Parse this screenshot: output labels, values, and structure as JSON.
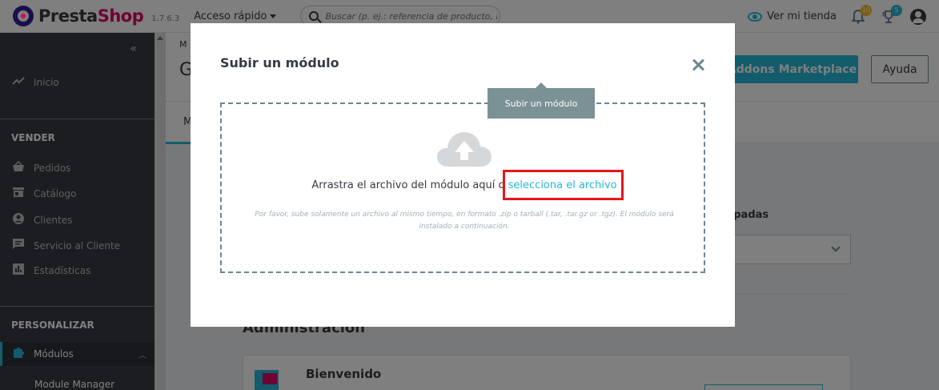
{
  "header": {
    "logo_part1": "Presta",
    "logo_part2": "Shop",
    "version": "1.7.6.3",
    "quick_access": "Acceso rápido",
    "search_placeholder": "Buscar (p. ej.: referencia de producto, no",
    "view_shop": "Ver mi tienda",
    "notifications_count": "10",
    "trophy_count": "5"
  },
  "sidebar": {
    "home": "Inicio",
    "section_sell": "VENDER",
    "items": [
      "Pedidos",
      "Catálogo",
      "Clientes",
      "Servicio al Cliente",
      "Estadísticas"
    ],
    "section_customize": "PERSONALIZAR",
    "active_item": "Módulos",
    "sub_item": "Module Manager"
  },
  "main": {
    "breadcrumb": "M",
    "title_fragment": "G",
    "tab_fragment": "M",
    "addons_button": "Addons Marketplace",
    "help_button": "Ayuda",
    "filter_label": "upadas",
    "section_heading": "Administración",
    "module_name": "Bienvenido"
  },
  "modal": {
    "title": "Subir un módulo",
    "tooltip": "Subir un módulo",
    "drop_text": "Arrastra el archivo del módulo aquí o ",
    "select_link": "selecciona el archivo",
    "hint": "Por favor, sube solamente un archivo al mismo tiempo, en formato .zip o tarball (.tar, .tar.gz or .tgz). El módulo será instalado a continuación."
  },
  "colors": {
    "accent": "#25b9d7",
    "brand_pink": "#df0067",
    "sidebar_bg": "#363a41",
    "highlight": "#e8141c"
  }
}
